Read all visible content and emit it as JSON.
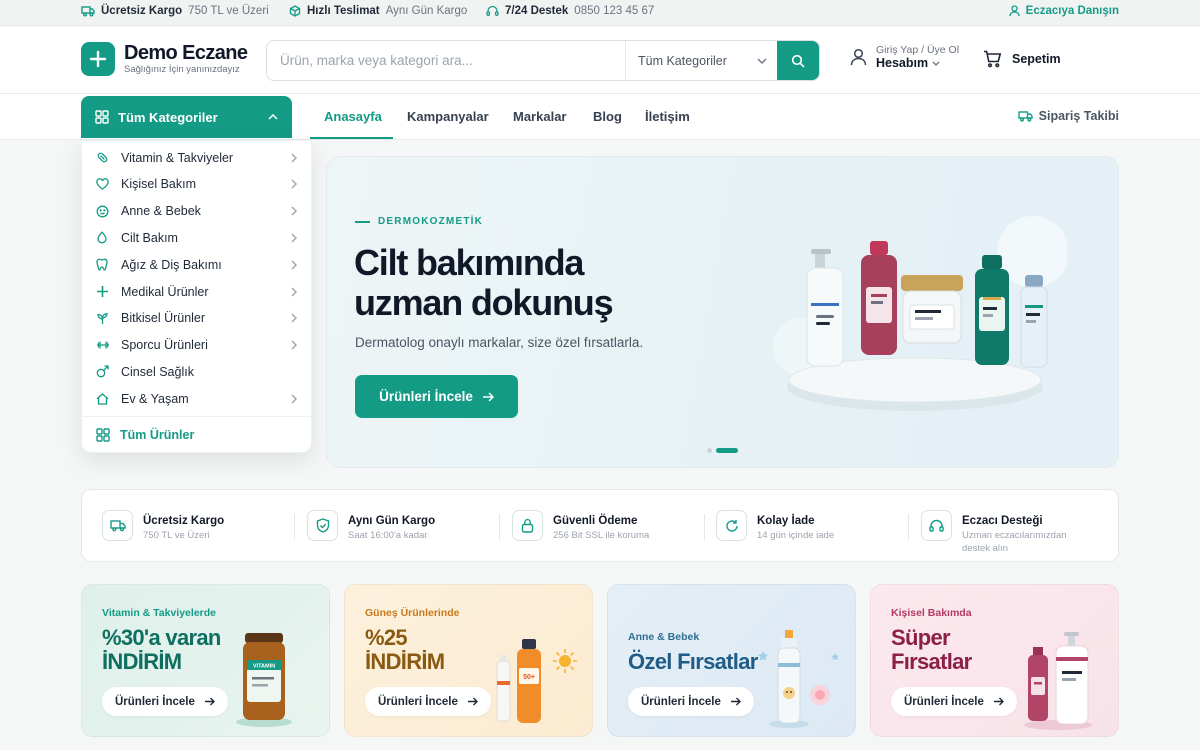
{
  "topbar": {
    "shipping_label": "Ücretsiz Kargo",
    "shipping_value": "750 TL ve Üzeri",
    "delivery_label": "Hızlı Teslimat",
    "delivery_value": "Aynı Gün Kargo",
    "support_label": "7/24 Destek",
    "support_phone": "0850 123 45 67",
    "pharmacist_link": "Eczacıya Danışın"
  },
  "header": {
    "logo_title": "Demo Eczane",
    "logo_subtitle": "Sağlığınız İçin yanınızdayız",
    "search_placeholder": "Ürün, marka veya kategori ara...",
    "search_category": "Tüm Kategoriler",
    "account_small": "Giriş Yap / Üye Ol",
    "account_label": "Hesabım",
    "cart_label": "Sepetim"
  },
  "nav": {
    "all_categories": "Tüm Kategoriler",
    "links": [
      "Anasayfa",
      "Kampanyalar",
      "Markalar",
      "Blog",
      "İletişim"
    ],
    "order_tracking": "Sipariş Takibi"
  },
  "categories": {
    "items": [
      {
        "label": "Vitamin & Takviyeler",
        "icon": "pill-icon",
        "has_arrow": true
      },
      {
        "label": "Kişisel Bakım",
        "icon": "heart-icon",
        "has_arrow": true
      },
      {
        "label": "Anne & Bebek",
        "icon": "baby-face-icon",
        "has_arrow": true
      },
      {
        "label": "Cilt Bakım",
        "icon": "drop-icon",
        "has_arrow": true
      },
      {
        "label": "Ağız & Diş Bakımı",
        "icon": "tooth-icon",
        "has_arrow": true
      },
      {
        "label": "Medikal Ürünler",
        "icon": "plus-icon",
        "has_arrow": true
      },
      {
        "label": "Bitkisel Ürünler",
        "icon": "leaf-icon",
        "has_arrow": true
      },
      {
        "label": "Sporcu Ürünleri",
        "icon": "dumbbell-icon",
        "has_arrow": true
      },
      {
        "label": "Cinsel Sağlık",
        "icon": "male-symbol-icon",
        "has_arrow": false
      },
      {
        "label": "Ev & Yaşam",
        "icon": "home-icon",
        "has_arrow": true
      }
    ],
    "all_products": "Tüm Ürünler"
  },
  "hero": {
    "kicker": "DERMOKOZMETİK",
    "title_line1": "Cilt bakımında",
    "title_line2": "uzman dokunuş",
    "subtitle": "Dermatolog onaylı markalar, size özel fırsatlarla.",
    "button": "Ürünleri İncele",
    "slide_count": 2,
    "active_slide": 2
  },
  "features": [
    {
      "title": "Ücretsiz Kargo",
      "subtitle": "750 TL ve Üzeri",
      "icon": "truck-icon"
    },
    {
      "title": "Aynı Gün Kargo",
      "subtitle": "Saat 16:00'a kadar",
      "icon": "shield-check-icon"
    },
    {
      "title": "Güvenli Ödeme",
      "subtitle": "256 Bit SSL ile koruma",
      "icon": "lock-icon"
    },
    {
      "title": "Kolay İade",
      "subtitle": "14 gün içinde iade",
      "icon": "refresh-icon"
    },
    {
      "title": "Eczacı Desteği",
      "subtitle": "Uzman eczacılarımızdan destek alın",
      "icon": "headset-icon"
    }
  ],
  "promos": [
    {
      "kicker": "Vitamin & Takviyelerde",
      "title_line1": "%30'a varan",
      "title_line2": "İNDİRİM",
      "button": "Ürünleri İncele",
      "accent": "#149b86",
      "title_color": "#0e6f60",
      "jar_label": "VITAMIN"
    },
    {
      "kicker": "Güneş Ürünlerinde",
      "title_line1": "%25",
      "title_line2": "İNDİRİM",
      "button": "Ürünleri İncele",
      "accent": "#c77a1d",
      "title_color": "#8a5a12",
      "bottle_label": "50+"
    },
    {
      "kicker": "Anne & Bebek",
      "title_line1": "Özel Fırsatlar",
      "title_line2": "",
      "button": "Ürünleri İncele",
      "accent": "#2d6f8f",
      "title_color": "#1f5d86"
    },
    {
      "kicker": "Kişisel Bakımda",
      "title_line1": "Süper",
      "title_line2": "Fırsatlar",
      "button": "Ürünleri İncele",
      "accent": "#b23a63",
      "title_color": "#8c1f47"
    }
  ]
}
